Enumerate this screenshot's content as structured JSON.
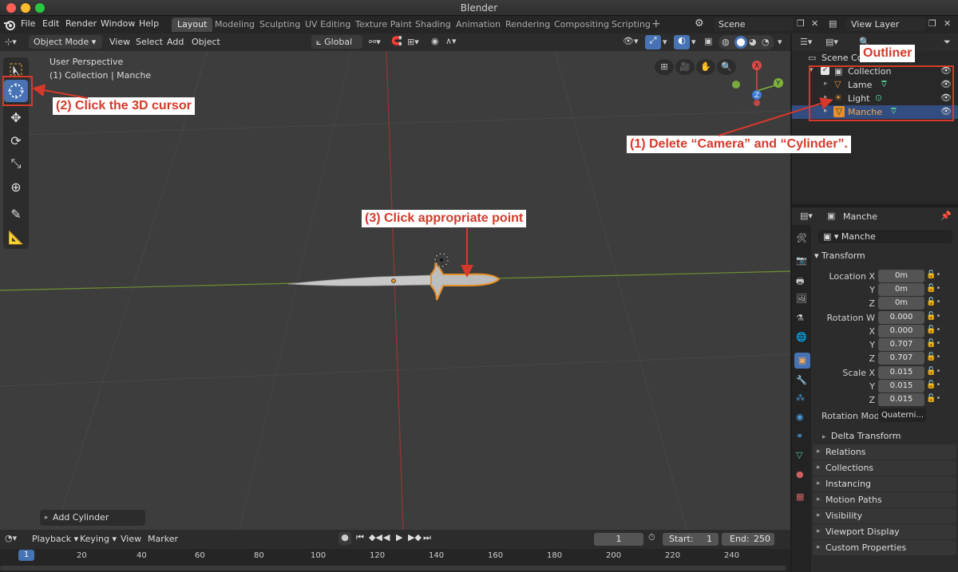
{
  "window": {
    "title": "Blender"
  },
  "menu": {
    "items": [
      "File",
      "Edit",
      "Render",
      "Window",
      "Help"
    ]
  },
  "workspaces": [
    "Layout",
    "Modeling",
    "Sculpting",
    "UV Editing",
    "Texture Paint",
    "Shading",
    "Animation",
    "Rendering",
    "Compositing",
    "Scripting"
  ],
  "scene": {
    "name": "Scene",
    "view_layer": "View Layer"
  },
  "viewport_header": {
    "mode": "Object Mode",
    "menus": [
      "View",
      "Select",
      "Add",
      "Object"
    ],
    "transform": "Global"
  },
  "viewport": {
    "perspective": "User Perspective",
    "info": "(1) Collection | Manche",
    "last_op": "Add Cylinder"
  },
  "gizmo": {
    "x": "X",
    "y": "Y",
    "z": "Z"
  },
  "outliner": {
    "title_row": "Scene Collection",
    "items": [
      {
        "label": "Collection"
      },
      {
        "label": "Lame"
      },
      {
        "label": "Light"
      },
      {
        "label": "Manche"
      }
    ]
  },
  "properties": {
    "object_name": "Manche",
    "data_name": "Manche",
    "transform_title": "Transform",
    "location": {
      "label": "Location X",
      "y": "Y",
      "z": "Z",
      "vx": "0m",
      "vy": "0m",
      "vz": "0m"
    },
    "rotation": {
      "label": "Rotation W",
      "x": "X",
      "y": "Y",
      "z": "Z",
      "vw": "0.000",
      "vx": "0.000",
      "vy": "0.707",
      "vz": "0.707"
    },
    "scale": {
      "label": "Scale X",
      "y": "Y",
      "z": "Z",
      "vx": "0.015",
      "vy": "0.015",
      "vz": "0.015"
    },
    "rotation_mode": {
      "label": "Rotation Mode",
      "value": "Quaterni..."
    },
    "delta": "Delta Transform",
    "panels": [
      "Relations",
      "Collections",
      "Instancing",
      "Motion Paths",
      "Visibility",
      "Viewport Display",
      "Custom Properties"
    ]
  },
  "timeline": {
    "menus": [
      "Playback",
      "Keying",
      "View",
      "Marker"
    ],
    "current_frame": "1",
    "start_label": "Start:",
    "start": "1",
    "end_label": "End:",
    "end": "250",
    "ticks": [
      "1",
      "20",
      "40",
      "60",
      "80",
      "100",
      "120",
      "140",
      "160",
      "180",
      "200",
      "220",
      "240"
    ]
  },
  "annotations": {
    "outliner": "Outliner",
    "step1": "(1) Delete “Camera” and “Cylinder”.",
    "step2": "(2) Click the 3D cursor",
    "step3": "(3) Click appropriate point"
  },
  "colors": {
    "accent": "#4772b3",
    "orange": "#e8902a",
    "annotation": "#d6392a"
  }
}
